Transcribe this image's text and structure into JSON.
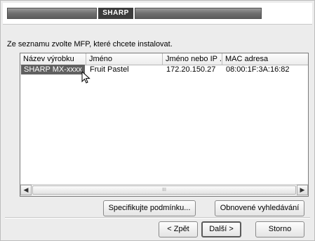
{
  "header": {
    "brand": "SHARP"
  },
  "instruction": "Ze seznamu zvolte MFP, které chcete instalovat.",
  "list": {
    "columns": [
      "Název výrobku",
      "Jméno",
      "Jméno nebo IP ...",
      "MAC adresa"
    ],
    "rows": [
      {
        "product": "SHARP MX-xxxx",
        "name": "Fruit Pastel",
        "ip": "172.20.150.27",
        "mac": "08:00:1F:3A:16:82"
      }
    ]
  },
  "buttons": {
    "specify": "Specifikujte podmínku...",
    "refresh": "Obnovené vyhledávání",
    "back": "< Zpět",
    "next": "Další >",
    "cancel": "Storno"
  },
  "icons": {
    "scroll_left": "◀",
    "scroll_right": "▶",
    "scroll_grip": "III"
  }
}
